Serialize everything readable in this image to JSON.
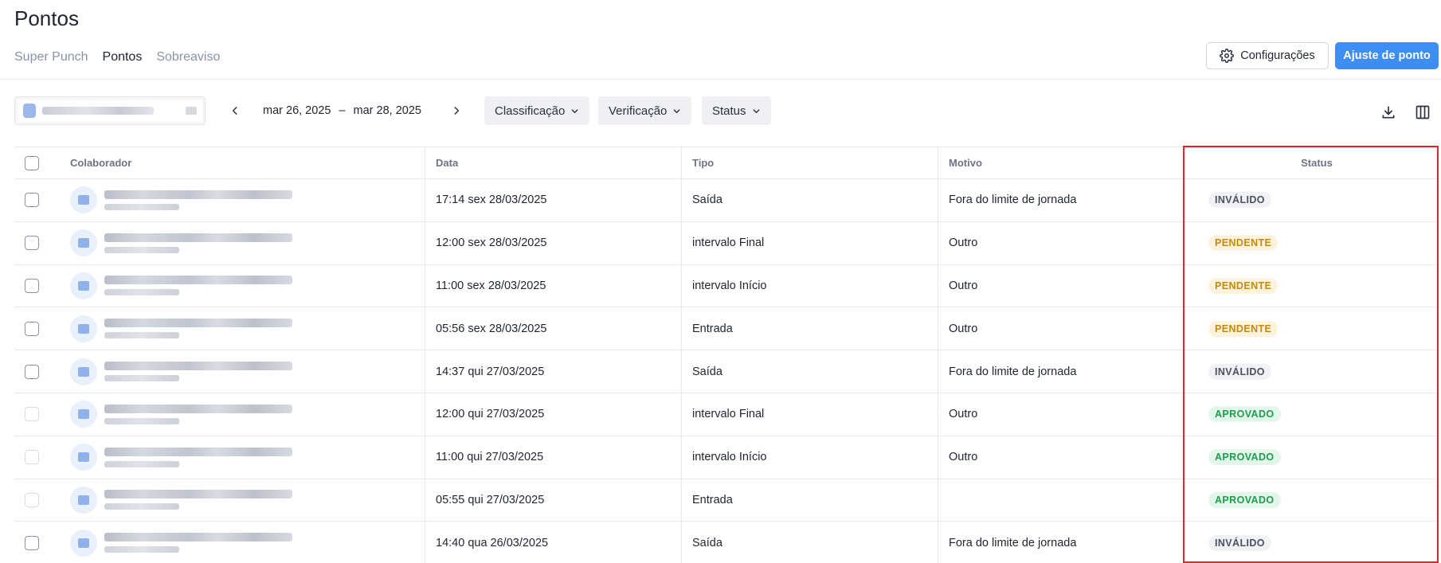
{
  "page": {
    "title": "Pontos"
  },
  "tabs": [
    {
      "label": "Super Punch",
      "active": false
    },
    {
      "label": "Pontos",
      "active": true
    },
    {
      "label": "Sobreaviso",
      "active": false
    }
  ],
  "actions": {
    "config_label": "Configurações",
    "ajuste_label": "Ajuste de ponto"
  },
  "filters": {
    "date_start": "mar 26, 2025",
    "date_sep": "–",
    "date_end": "mar 28, 2025",
    "classificacao": "Classificação",
    "verificacao": "Verificação",
    "status": "Status"
  },
  "table": {
    "headers": {
      "colaborador": "Colaborador",
      "data": "Data",
      "tipo": "Tipo",
      "motivo": "Motivo",
      "status": "Status"
    },
    "rows": [
      {
        "data": "17:14 sex 28/03/2025",
        "tipo": "Saída",
        "motivo": "Fora do limite de jornada",
        "status": "INVÁLIDO",
        "status_kind": "invalido",
        "checkbox_enabled": true
      },
      {
        "data": "12:00 sex 28/03/2025",
        "tipo": "intervalo Final",
        "motivo": "Outro",
        "status": "PENDENTE",
        "status_kind": "pendente",
        "checkbox_enabled": true
      },
      {
        "data": "11:00 sex 28/03/2025",
        "tipo": "intervalo Início",
        "motivo": "Outro",
        "status": "PENDENTE",
        "status_kind": "pendente",
        "checkbox_enabled": true
      },
      {
        "data": "05:56 sex 28/03/2025",
        "tipo": "Entrada",
        "motivo": "Outro",
        "status": "PENDENTE",
        "status_kind": "pendente",
        "checkbox_enabled": true
      },
      {
        "data": "14:37 qui 27/03/2025",
        "tipo": "Saída",
        "motivo": "Fora do limite de jornada",
        "status": "INVÁLIDO",
        "status_kind": "invalido",
        "checkbox_enabled": true
      },
      {
        "data": "12:00 qui 27/03/2025",
        "tipo": "intervalo Final",
        "motivo": "Outro",
        "status": "APROVADO",
        "status_kind": "aprovado",
        "checkbox_enabled": false
      },
      {
        "data": "11:00 qui 27/03/2025",
        "tipo": "intervalo Início",
        "motivo": "Outro",
        "status": "APROVADO",
        "status_kind": "aprovado",
        "checkbox_enabled": false
      },
      {
        "data": "05:55 qui 27/03/2025",
        "tipo": "Entrada",
        "motivo": "",
        "status": "APROVADO",
        "status_kind": "aprovado",
        "checkbox_enabled": false
      },
      {
        "data": "14:40 qua 26/03/2025",
        "tipo": "Saída",
        "motivo": "Fora do limite de jornada",
        "status": "INVÁLIDO",
        "status_kind": "invalido",
        "checkbox_enabled": true
      }
    ]
  },
  "colors": {
    "primary": "#3d8ef0",
    "highlight": "#e0262c"
  }
}
